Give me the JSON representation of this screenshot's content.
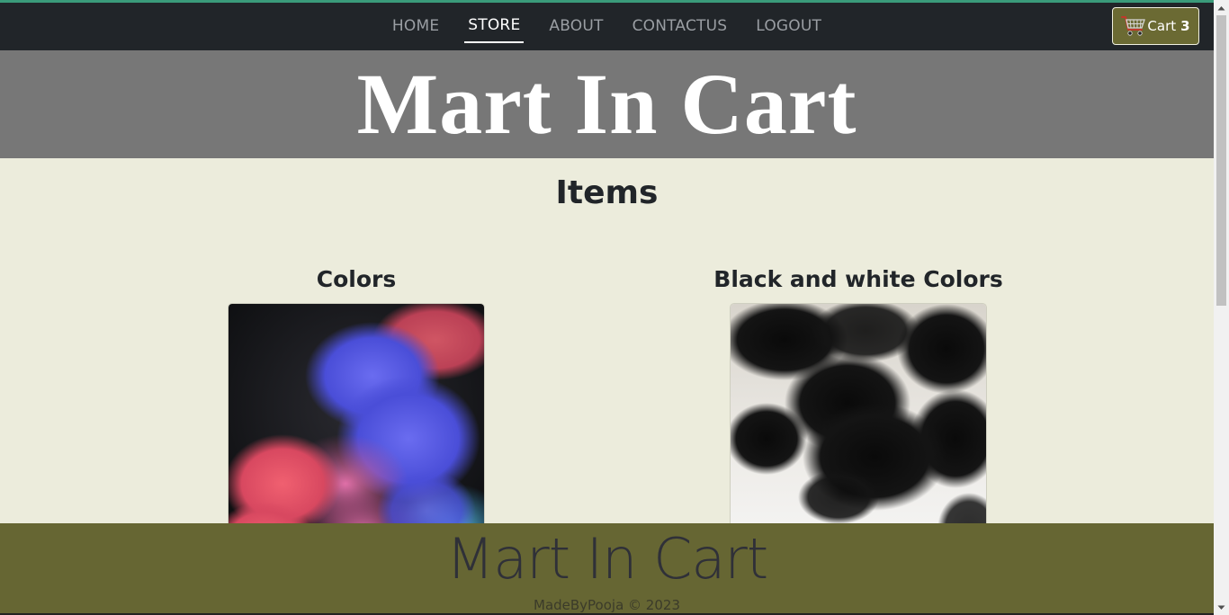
{
  "nav": {
    "links": [
      {
        "label": "HOME",
        "active": false
      },
      {
        "label": "STORE",
        "active": true
      },
      {
        "label": "ABOUT",
        "active": false
      },
      {
        "label": "CONTACTUS",
        "active": false
      },
      {
        "label": "LOGOUT",
        "active": false
      }
    ],
    "cart": {
      "label": "Cart",
      "count": "3",
      "icon": "shopping-cart-icon"
    }
  },
  "hero": {
    "title": "Mart In Cart"
  },
  "section": {
    "title": "Items"
  },
  "items": [
    {
      "title": "Colors",
      "image": "colorful-smoke-image"
    },
    {
      "title": "Black and white Colors",
      "image": "black-ink-smoke-image"
    }
  ],
  "footer": {
    "title": "Mart In Cart",
    "credit": "MadeByPooja © 2023"
  },
  "colors": {
    "navbar": "#212529",
    "hero": "#777777",
    "page_bg": "#ececdc",
    "footer": "#666633",
    "cart_button": "#6b6a33"
  }
}
